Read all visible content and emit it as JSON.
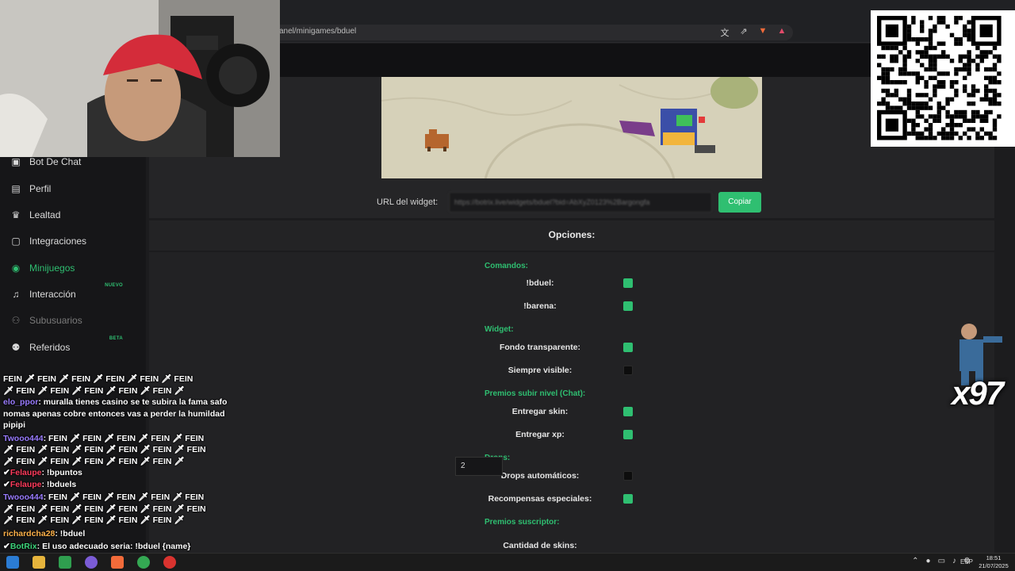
{
  "browser": {
    "url": "anel/minigames/bduel"
  },
  "sidebar": {
    "items": [
      {
        "label": "Bot De Chat",
        "icon": "robot-icon",
        "state": "normal"
      },
      {
        "label": "Perfil",
        "icon": "id-card-icon",
        "state": "normal"
      },
      {
        "label": "Lealtad",
        "icon": "trophy-icon",
        "state": "normal"
      },
      {
        "label": "Integraciones",
        "icon": "integrations-icon",
        "state": "normal"
      },
      {
        "label": "Minijuegos",
        "icon": "gamepad-icon",
        "state": "active"
      },
      {
        "label": "Interacción",
        "icon": "music-note-icon",
        "state": "normal",
        "badge": "NUEVO"
      },
      {
        "label": "Subusuarios",
        "icon": "users-icon",
        "state": "disabled"
      },
      {
        "label": "Referidos",
        "icon": "people-icon",
        "state": "normal",
        "badge": "BETA"
      }
    ]
  },
  "widget": {
    "url_label": "URL del widget:",
    "url_value": "https://botrix.live/widgets/bduel?bid=AbXyZ0123%2Bargongfa",
    "copy_label": "Copiar"
  },
  "options": {
    "title": "Opciones:",
    "sections": [
      {
        "title": "Comandos:",
        "items": [
          {
            "label": "!bduel:",
            "checked": true
          },
          {
            "label": "!barena:",
            "checked": true
          }
        ]
      },
      {
        "title": "Widget:",
        "items": [
          {
            "label": "Fondo transparente:",
            "checked": true
          },
          {
            "label": "Siempre visible:",
            "checked": false
          }
        ]
      },
      {
        "title": "Premios subir nivel (Chat):",
        "items": [
          {
            "label": "Entregar skin:",
            "checked": true
          },
          {
            "label": "Entregar xp:",
            "checked": true
          }
        ]
      },
      {
        "title": "Drops:",
        "items": [
          {
            "label": "Drops automáticos:",
            "checked": false
          },
          {
            "label": "Recompensas especiales:",
            "checked": true
          }
        ]
      },
      {
        "title": "Premios suscriptor:",
        "items": [
          {
            "label": "Cantidad de skins:",
            "value": "2"
          }
        ]
      }
    ]
  },
  "overlay": {
    "multiplier": "x97",
    "chat": [
      {
        "user": "",
        "text": "FEIN 🗡 FEIN 🗡 FEIN 🗡 FEIN 🗡 FEIN 🗡 FEIN"
      },
      {
        "user": "",
        "text": "🗡 FEIN 🗡 FEIN 🗡 FEIN 🗡 FEIN 🗡 FEIN 🗡"
      },
      {
        "user": "elo_ppor",
        "color": "purple",
        "text": "muralla tienes casino se te subira la fama safo nomas apenas cobre entonces vas a perder la humildad pipipi"
      },
      {
        "user": "Twooo444",
        "color": "purple",
        "text": "FEIN 🗡 FEIN 🗡 FEIN 🗡 FEIN 🗡 FEIN"
      },
      {
        "user": "",
        "text": "🗡 FEIN 🗡 FEIN 🗡 FEIN 🗡 FEIN 🗡 FEIN 🗡 FEIN"
      },
      {
        "user": "",
        "text": "🗡 FEIN 🗡 FEIN 🗡 FEIN 🗡 FEIN 🗡 FEIN 🗡"
      },
      {
        "user": "Felaupe",
        "color": "red",
        "text": "!bpuntos"
      },
      {
        "user": "Felaupe",
        "color": "red",
        "text": "!bduels"
      },
      {
        "user": "Twooo444",
        "color": "purple",
        "text": "FEIN 🗡 FEIN 🗡 FEIN 🗡 FEIN 🗡 FEIN"
      },
      {
        "user": "",
        "text": "🗡 FEIN 🗡 FEIN 🗡 FEIN 🗡 FEIN 🗡 FEIN 🗡 FEIN"
      },
      {
        "user": "",
        "text": "🗡 FEIN 🗡 FEIN 🗡 FEIN 🗡 FEIN 🗡 FEIN 🗡"
      },
      {
        "user": "richardcha28",
        "color": "orange",
        "text": "!bduel"
      },
      {
        "user": "BotRix",
        "color": "green",
        "text": "El uso adecuado seria: !bduel {name}"
      }
    ]
  },
  "taskbar": {
    "lang": "ESP",
    "time": "18:51",
    "date": "21/07/2025"
  },
  "colors": {
    "accent": "#2fbf71",
    "sidebar_bg": "#161618",
    "panel_bg": "#252527"
  }
}
